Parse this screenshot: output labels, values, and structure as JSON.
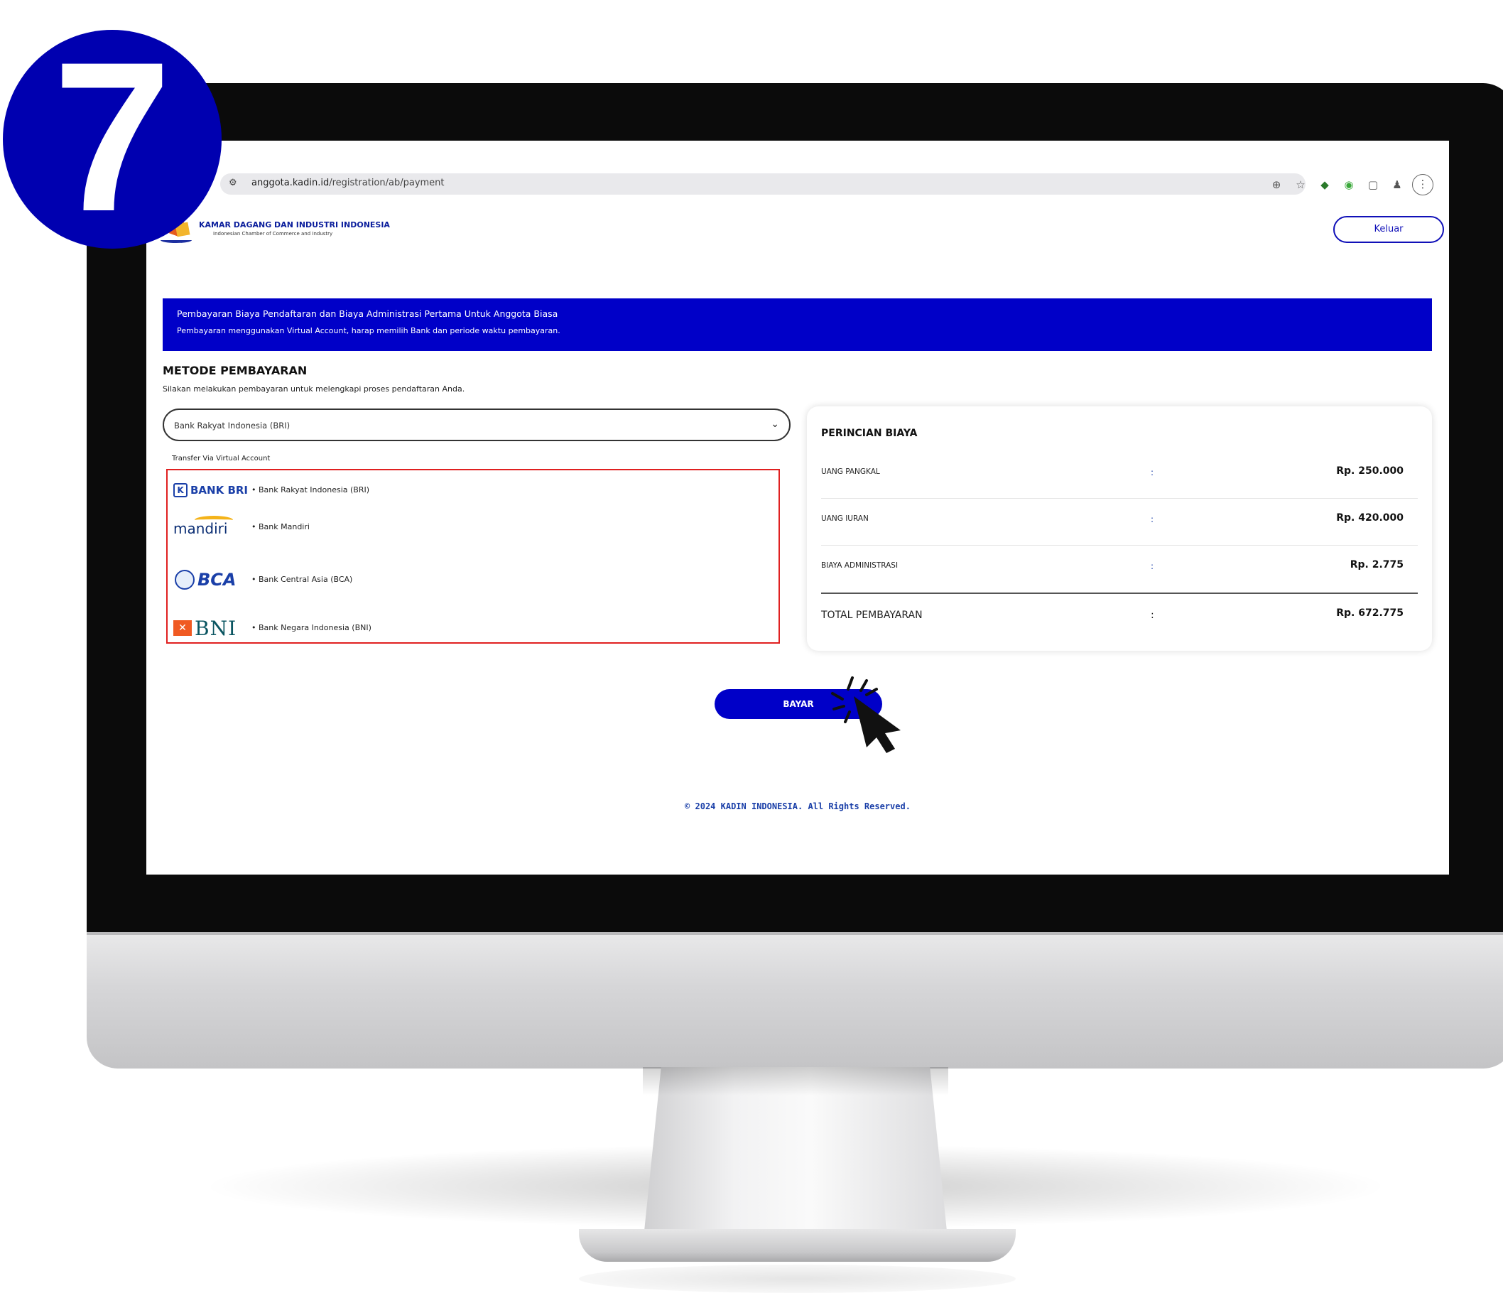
{
  "step_number": "7",
  "browser": {
    "url_host": "anggota.kadin.id",
    "url_path": "/registration/ab/payment",
    "icons": [
      "zoom-icon",
      "star-icon",
      "extension-icon",
      "chat-extension-icon",
      "puzzle-icon",
      "profile-icon",
      "menu-icon"
    ]
  },
  "header": {
    "brand_title": "KAMAR DAGANG DAN INDUSTRI INDONESIA",
    "brand_subtitle": "Indonesian Chamber of Commerce and Industry",
    "logout_label": "Keluar"
  },
  "banner": {
    "title": "Pembayaran Biaya Pendaftaran dan Biaya Administrasi Pertama Untuk Anggota Biasa",
    "subtitle": "Pembayaran menggunakan Virtual Account, harap memilih Bank dan periode waktu pembayaran."
  },
  "payment_method": {
    "title": "METODE PEMBAYARAN",
    "subtitle": "Silakan melakukan pembayaran untuk melengkapi proses pendaftaran Anda.",
    "selected_bank": "Bank Rakyat Indonesia (BRI)",
    "options_caption": "Transfer Via Virtual Account",
    "banks": [
      {
        "logo_text": "BANK BRI",
        "name": "•   Bank Rakyat Indonesia (BRI)"
      },
      {
        "logo_text": "mandiri",
        "name": "•   Bank Mandiri"
      },
      {
        "logo_text": "BCA",
        "name": "•   Bank Central Asia (BCA)"
      },
      {
        "logo_text": "BNI",
        "name": "•   Bank Negara Indonesia (BNI)"
      }
    ]
  },
  "fee_details": {
    "title": "PERINCIAN BIAYA",
    "rows": [
      {
        "label": "UANG PANGKAL",
        "sep": ":",
        "amount": "Rp. 250.000"
      },
      {
        "label": "UANG IURAN",
        "sep": ":",
        "amount": "Rp. 420.000"
      },
      {
        "label": "BIAYA ADMINISTRASI",
        "sep": ":",
        "amount": "Rp. 2.775"
      }
    ],
    "total": {
      "label": "TOTAL PEMBAYARAN",
      "sep": ":",
      "amount": "Rp. 672.775"
    }
  },
  "pay_button_label": "BAYAR",
  "footer": "© 2024 KADIN INDONESIA. All Rights Reserved.",
  "colors": {
    "primary": "#0000c8",
    "highlight_border": "#e02020",
    "badge": "#0000b0"
  }
}
